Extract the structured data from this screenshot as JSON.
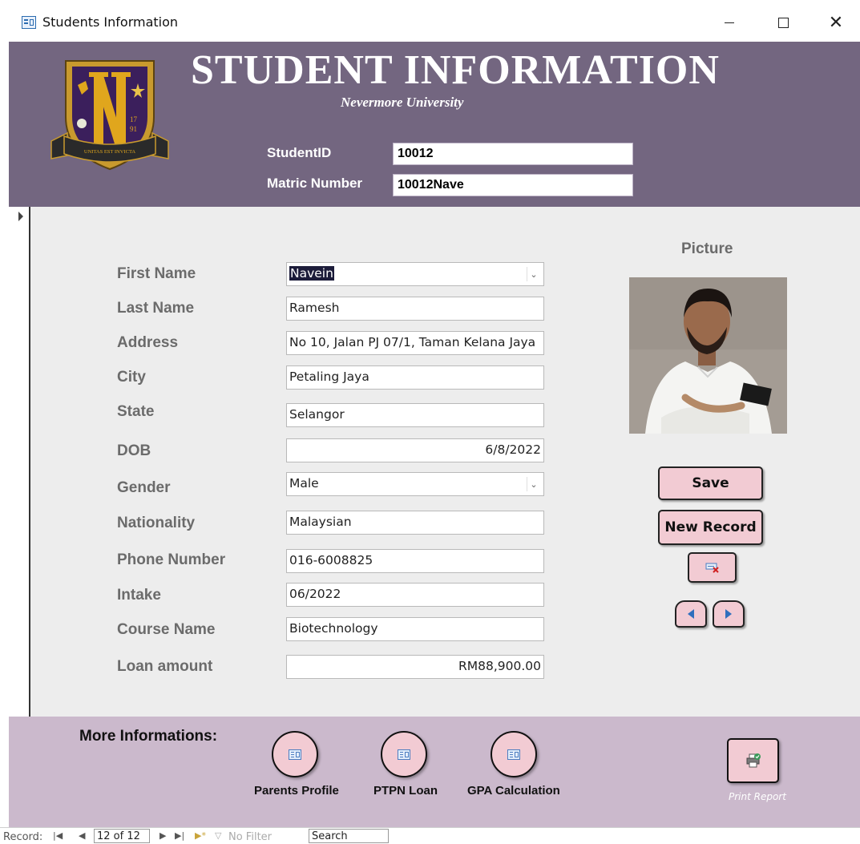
{
  "window": {
    "title": "Students Information",
    "minimize_icon": "minimize-icon",
    "maximize_icon": "maximize-icon",
    "close_icon": "close-icon"
  },
  "header": {
    "title": "STUDENT INFORMATION",
    "subtitle": "Nevermore University",
    "crest_motto": "UNITAS EST INVICTA",
    "crest_letter": "N",
    "crest_year_top": "17",
    "crest_year_bottom": "91",
    "student_id_label": "StudentID",
    "student_id_value": "10012",
    "matric_label": "Matric Number",
    "matric_value": "10012Nave",
    "background_color": "#736680"
  },
  "form": {
    "fields": [
      {
        "label": "First Name",
        "value": "Navein"
      },
      {
        "label": "Last Name",
        "value": "Ramesh"
      },
      {
        "label": "Address",
        "value": "No 10, Jalan PJ 07/1, Taman Kelana Jaya"
      },
      {
        "label": "City",
        "value": "Petaling Jaya"
      },
      {
        "label": "State",
        "value": "Selangor"
      },
      {
        "label": "DOB",
        "value": "6/8/2022"
      },
      {
        "label": "Gender",
        "value": "Male"
      },
      {
        "label": "Nationality",
        "value": "Malaysian"
      },
      {
        "label": "Phone Number",
        "value": "016-6008825"
      },
      {
        "label": "Intake",
        "value": "06/2022"
      },
      {
        "label": "Course Name",
        "value": "Biotechnology"
      },
      {
        "label": "Loan amount",
        "value": "RM88,900.00"
      }
    ],
    "picture_label": "Picture"
  },
  "actions": {
    "save_label": "Save",
    "new_record_label": "New Record",
    "delete_icon": "delete-record-icon",
    "prev_icon": "previous-record-icon",
    "next_icon": "next-record-icon",
    "button_color": "#f2cbd3"
  },
  "footer": {
    "more_info_label": "More Informations:",
    "buttons": [
      {
        "label": "Parents Profile"
      },
      {
        "label": "PTPN Loan"
      },
      {
        "label": "GPA Calculation"
      }
    ],
    "print_label": "Print Report",
    "background_color": "#cbb9cc"
  },
  "navbar": {
    "record_label": "Record:",
    "position": "12 of 12",
    "filter_label": "No Filter",
    "search_label": "Search"
  }
}
